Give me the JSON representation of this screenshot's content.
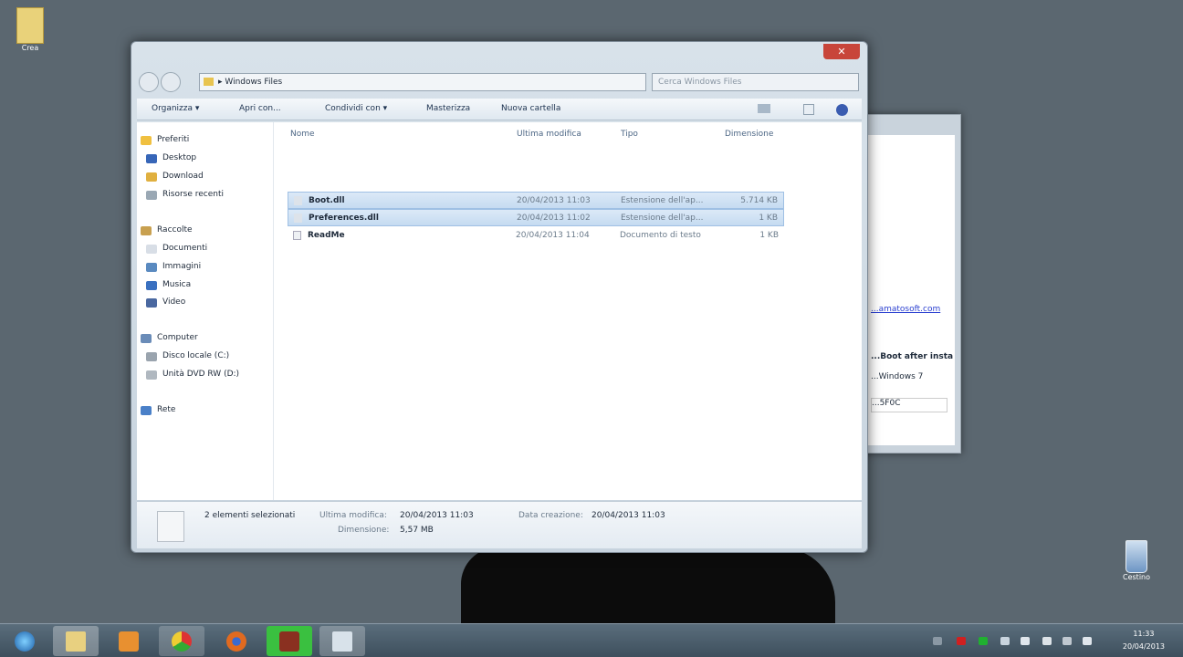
{
  "desktop": {
    "icons": [
      {
        "label": "Crea"
      },
      {
        "label": "Cestino"
      }
    ]
  },
  "background_window": {
    "link": "...amatosoft.com",
    "line1": "...Boot after install",
    "line2": "...Windows 7",
    "field": "...5F0C"
  },
  "explorer": {
    "close": "✕",
    "address": "Windows Files",
    "search_placeholder": "Cerca Windows Files",
    "toolbar": {
      "organize": "Organizza ▾",
      "open_with": "Apri con...",
      "share": "Condividi con ▾",
      "burn": "Masterizza",
      "new_folder": "Nuova cartella"
    },
    "sidebar": {
      "favorites": "Preferiti",
      "desktop": "Desktop",
      "download": "Download",
      "recent": "Risorse recenti",
      "libraries": "Raccolte",
      "documents": "Documenti",
      "images": "Immagini",
      "music": "Musica",
      "video": "Video",
      "computer": "Computer",
      "local_disk": "Disco locale (C:)",
      "dvd": "Unità DVD RW (D:)",
      "network": "Rete"
    },
    "columns": [
      "Nome",
      "Ultima modifica",
      "Tipo",
      "Dimensione"
    ],
    "files": [
      {
        "name": "Boot.dll",
        "modified": "20/04/2013 11:03",
        "type": "Estensione dell'ap...",
        "size": "5.714 KB",
        "selected": true
      },
      {
        "name": "Preferences.dll",
        "modified": "20/04/2013 11:02",
        "type": "Estensione dell'ap...",
        "size": "1 KB",
        "selected": true
      },
      {
        "name": "ReadMe",
        "modified": "20/04/2013 11:04",
        "type": "Documento di testo",
        "size": "1 KB",
        "selected": false
      }
    ],
    "details": {
      "count": "2 elementi selezionati",
      "modified_label": "Ultima modifica:",
      "modified": "20/04/2013 11:03",
      "created_label": "Data creazione:",
      "created": "20/04/2013 11:03",
      "size_label": "Dimensione:",
      "size": "5,57 MB"
    }
  },
  "taskbar": {
    "time": "11:33",
    "date": "20/04/2013"
  }
}
